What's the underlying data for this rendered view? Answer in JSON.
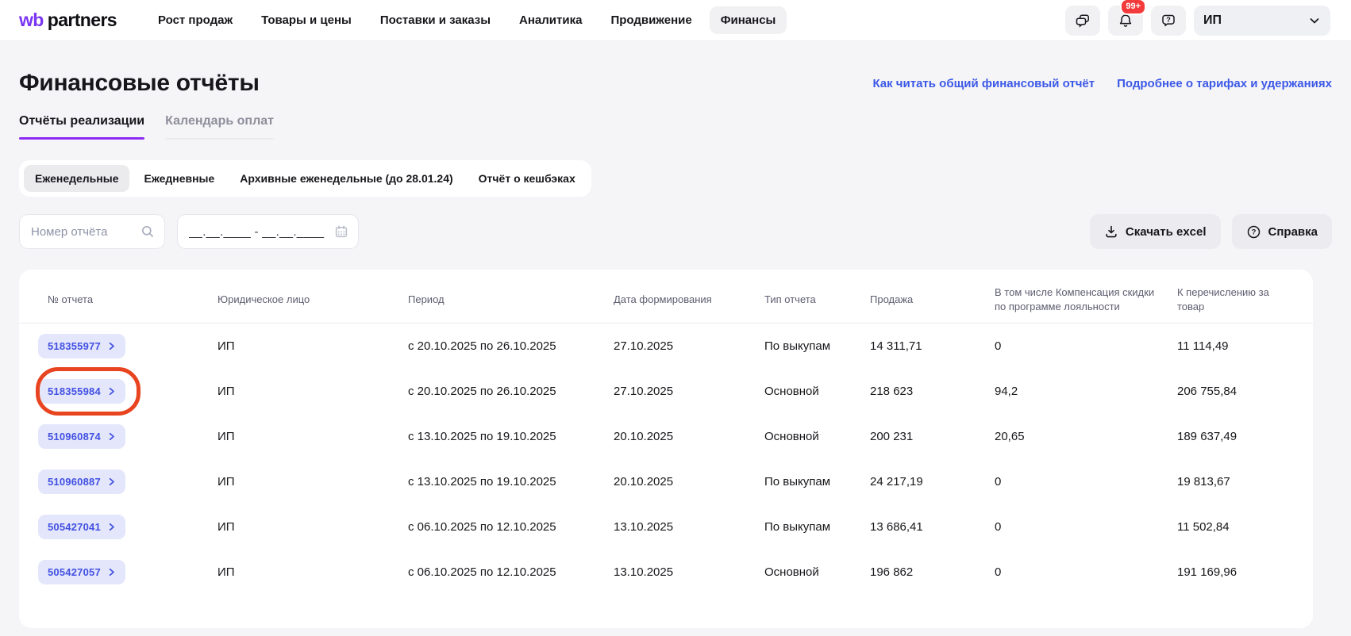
{
  "brand": {
    "wb": "wb",
    "partners": "partners"
  },
  "nav": {
    "items": [
      "Рост продаж",
      "Товары и цены",
      "Поставки и заказы",
      "Аналитика",
      "Продвижение",
      "Финансы"
    ],
    "active": "Финансы"
  },
  "notifications": {
    "badge": "99+"
  },
  "account": {
    "label": "ИП"
  },
  "icons": {
    "topbar": [
      "chat-icon",
      "bell-icon",
      "help-bubble-icon",
      "chevron-down-icon"
    ],
    "toolbar": [
      "search-icon",
      "calendar-icon",
      "download-icon",
      "question-circle-icon"
    ],
    "row": "chevron-right-icon",
    "annotation": "highlight-circle"
  },
  "header": {
    "title": "Финансовые отчёты",
    "links": [
      {
        "label": "Как читать общий финансовый отчёт"
      },
      {
        "label": "Подробнее о тарифах и удержаниях"
      }
    ]
  },
  "tabs": [
    {
      "label": "Отчёты реализации",
      "active": true
    },
    {
      "label": "Календарь оплат",
      "active": false
    }
  ],
  "chips": [
    {
      "label": "Еженедельные",
      "active": true
    },
    {
      "label": "Ежедневные",
      "active": false
    },
    {
      "label": "Архивные еженедельные (до 28.01.24)",
      "active": false
    },
    {
      "label": "Отчёт о кешбэках",
      "active": false
    }
  ],
  "toolbar": {
    "search_placeholder": "Номер отчёта",
    "date_placeholder": "__.__.____ - __.__.____",
    "download_label": "Скачать excel",
    "help_label": "Справка"
  },
  "table": {
    "columns": [
      "№ отчета",
      "Юридическое лицо",
      "Период",
      "Дата формирования",
      "Тип отчета",
      "Продажа",
      "В том числе Компенсация скидки по программе лояльности",
      "К перечислению за товар"
    ],
    "rows": [
      {
        "id": "518355977",
        "entity": "ИП",
        "period": "с 20.10.2025 по 26.10.2025",
        "formed": "27.10.2025",
        "type": "По выкупам",
        "sale": "14 311,71",
        "compensation": "0",
        "transfer": "11 114,49",
        "highlighted": false
      },
      {
        "id": "518355984",
        "entity": "ИП",
        "period": "с 20.10.2025 по 26.10.2025",
        "formed": "27.10.2025",
        "type": "Основной",
        "sale": "218 623",
        "compensation": "94,2",
        "transfer": "206 755,84",
        "highlighted": true
      },
      {
        "id": "510960874",
        "entity": "ИП",
        "period": "с 13.10.2025 по 19.10.2025",
        "formed": "20.10.2025",
        "type": "Основной",
        "sale": "200 231",
        "compensation": "20,65",
        "transfer": "189 637,49",
        "highlighted": false
      },
      {
        "id": "510960887",
        "entity": "ИП",
        "period": "с 13.10.2025 по 19.10.2025",
        "formed": "20.10.2025",
        "type": "По выкупам",
        "sale": "24 217,19",
        "compensation": "0",
        "transfer": "19 813,67",
        "highlighted": false
      },
      {
        "id": "505427041",
        "entity": "ИП",
        "period": "с 06.10.2025 по 12.10.2025",
        "formed": "13.10.2025",
        "type": "По выкупам",
        "sale": "13 686,41",
        "compensation": "0",
        "transfer": "11 502,84",
        "highlighted": false
      },
      {
        "id": "505427057",
        "entity": "ИП",
        "period": "с 06.10.2025 по 12.10.2025",
        "formed": "13.10.2025",
        "type": "Основной",
        "sale": "196 862",
        "compensation": "0",
        "transfer": "191 169,96",
        "highlighted": false
      }
    ]
  },
  "colors": {
    "accent_purple": "#8d2bf4",
    "logo_purple": "#7a35f2",
    "link_blue": "#3c58e6",
    "pill_blue": "#4250e2",
    "annotation_red": "#e8441f",
    "badge_red": "#f43b3b",
    "page_background": "#f5f5f8"
  }
}
